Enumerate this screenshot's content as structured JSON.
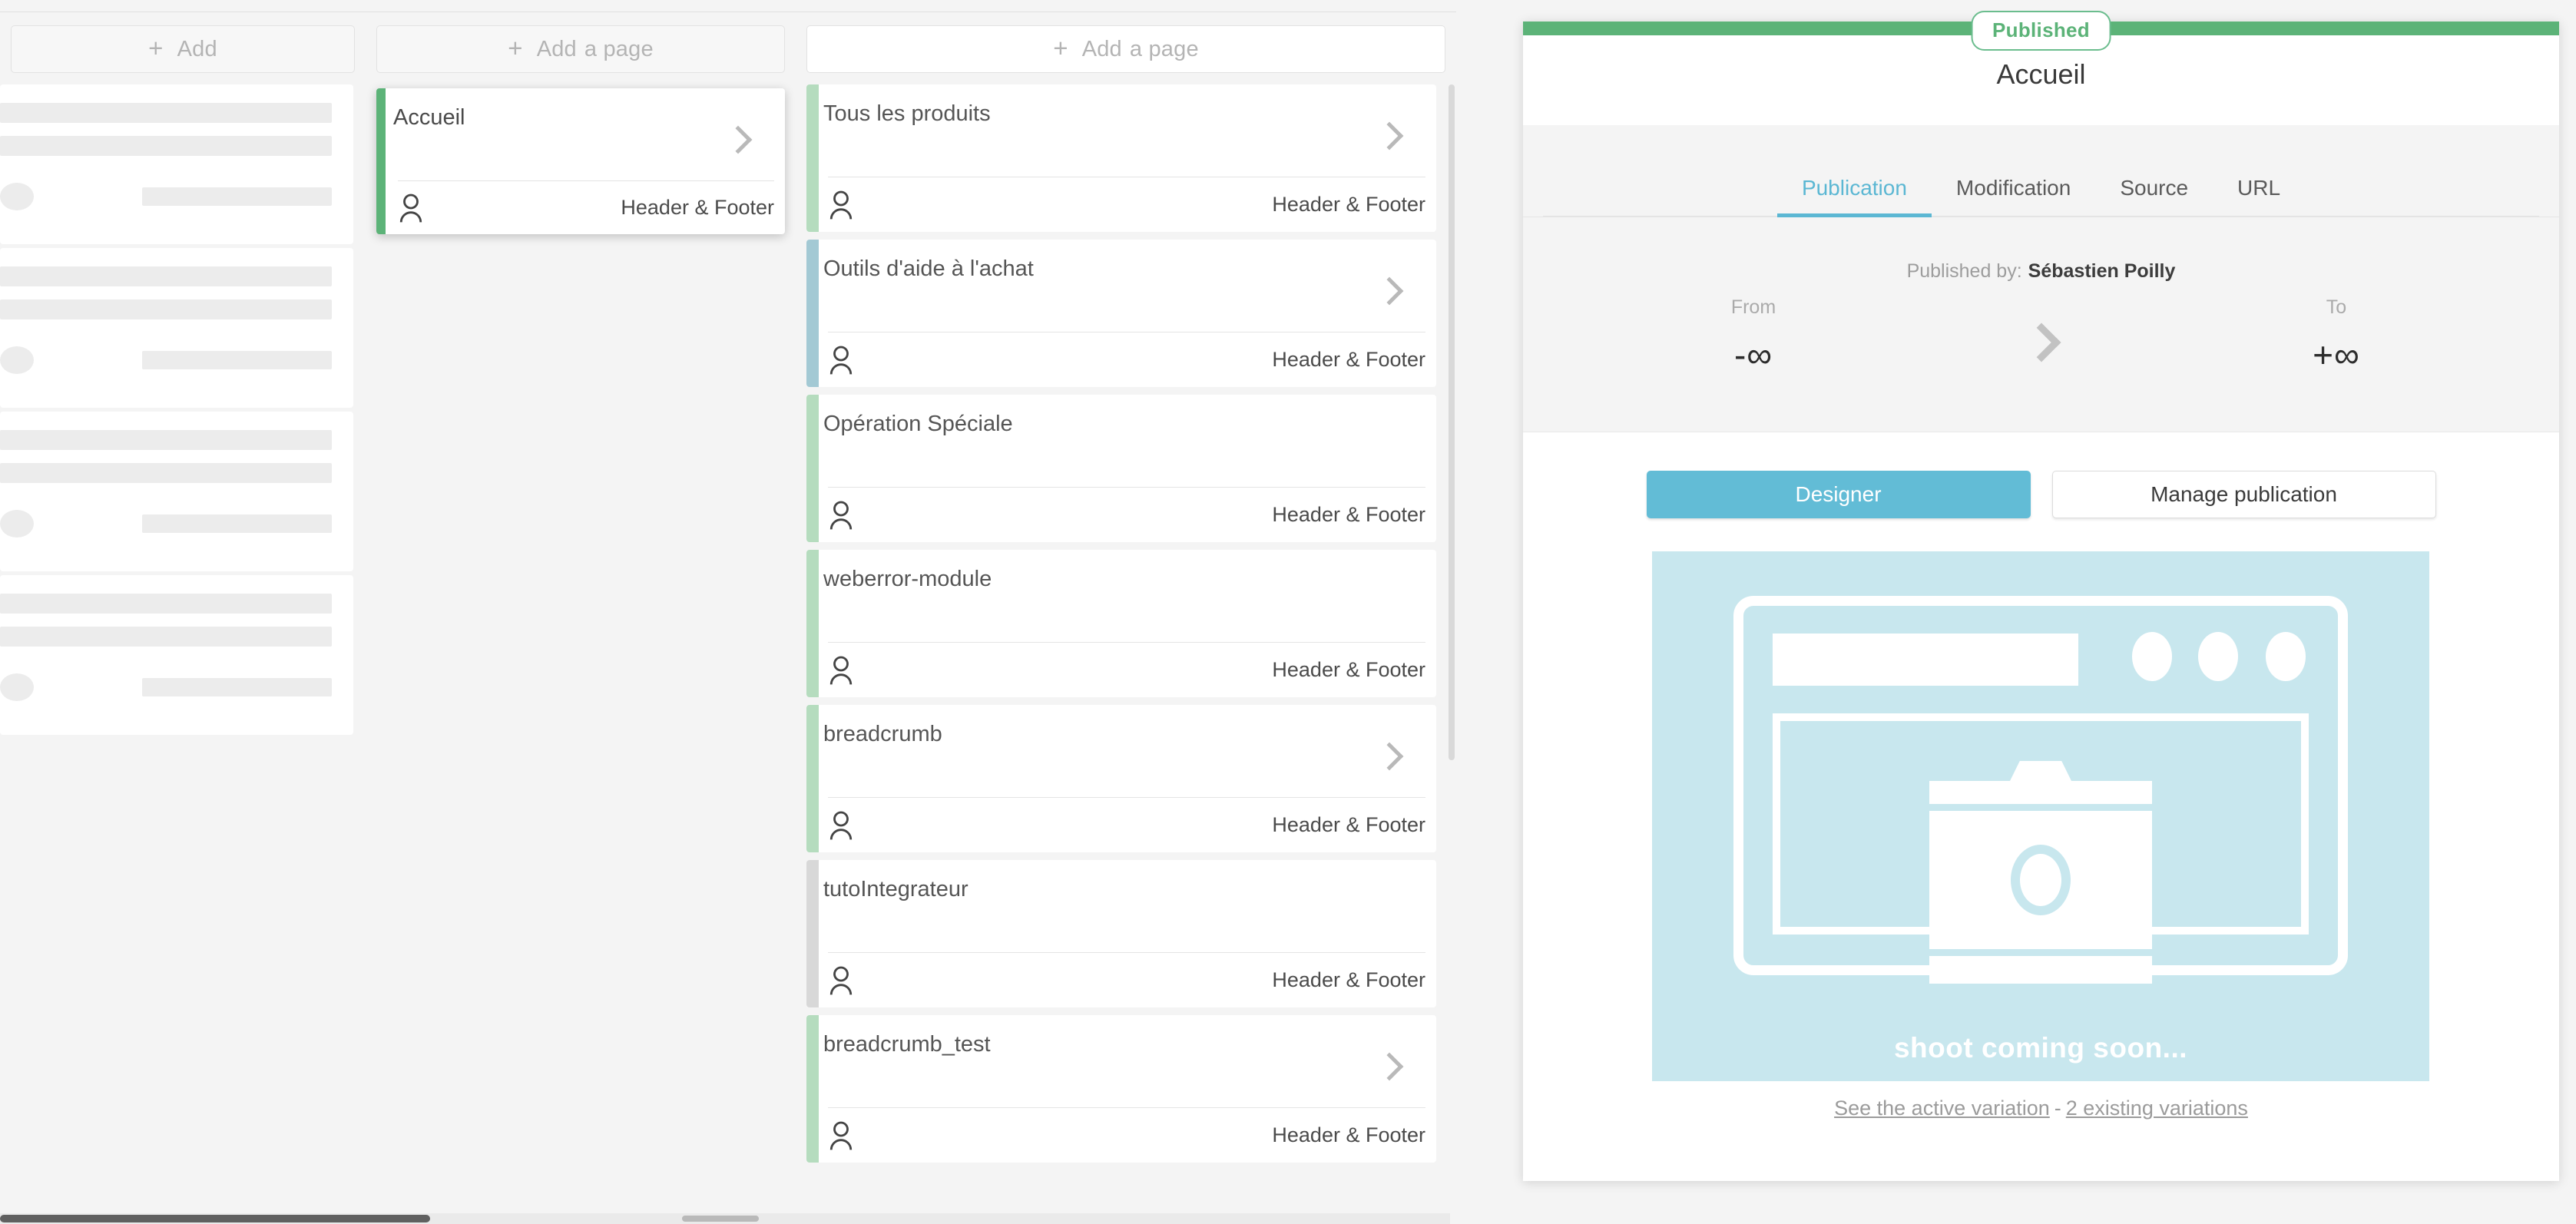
{
  "columns": {
    "skeleton": {
      "add_label": "Add",
      "plus_icon": "plus-icon",
      "placeholder_cards": 4
    },
    "selected": {
      "add_label": "Add",
      "add_label2": "a page",
      "plus_icon": "plus-icon",
      "cards": [
        {
          "title": "Accueil",
          "footer": "Header & Footer",
          "stripe_color": "#5cb378",
          "has_chevron": true,
          "person_icon": "person-icon",
          "selected": true
        }
      ]
    },
    "pages": {
      "add_label": "Add",
      "add_label2": "a page",
      "plus_icon": "plus-icon",
      "cards": [
        {
          "title": "Tous les produits",
          "footer": "Header & Footer",
          "stripe_color": "#b5dcbe",
          "has_chevron": true,
          "person_icon": "person-icon"
        },
        {
          "title": "Outils d'aide à l'achat",
          "footer": "Header & Footer",
          "stripe_color": "#a3c9d4",
          "has_chevron": true,
          "person_icon": "person-icon"
        },
        {
          "title": "Opération Spéciale",
          "footer": "Header & Footer",
          "stripe_color": "#b5dcbe",
          "has_chevron": false,
          "person_icon": "person-icon"
        },
        {
          "title": "weberror-module",
          "footer": "Header & Footer",
          "stripe_color": "#b5dcbe",
          "has_chevron": false,
          "person_icon": "person-icon"
        },
        {
          "title": "breadcrumb",
          "footer": "Header & Footer",
          "stripe_color": "#b5dcbe",
          "has_chevron": true,
          "person_icon": "person-icon"
        },
        {
          "title": "tutoIntegrateur",
          "footer": "Header & Footer",
          "stripe_color": "#d8d8d8",
          "has_chevron": false,
          "person_icon": "person-icon"
        },
        {
          "title": "breadcrumb_test",
          "footer": "Header & Footer",
          "stripe_color": "#b5dcbe",
          "has_chevron": true,
          "person_icon": "person-icon"
        }
      ]
    }
  },
  "detail": {
    "status": "Published",
    "status_color": "#5cb378",
    "title": "Accueil",
    "tabs": [
      {
        "label": "Publication",
        "active": true
      },
      {
        "label": "Modification",
        "active": false
      },
      {
        "label": "Source",
        "active": false
      },
      {
        "label": "URL",
        "active": false
      }
    ],
    "published_by_label": "Published by:",
    "published_by_name": "Sébastien Poilly",
    "range": {
      "from_label": "From",
      "from_value": "-∞",
      "to_label": "To",
      "to_value": "+∞",
      "arrow_icon": "chevron-right-icon"
    },
    "buttons": {
      "primary": "Designer",
      "secondary": "Manage publication",
      "primary_color": "#62bcd6"
    },
    "preview": {
      "caption": "shoot coming soon...",
      "icon": "camera-placeholder-icon",
      "background_color": "#c8e7ee"
    },
    "variations": {
      "active_link": "See the active variation",
      "separator": "-",
      "count_link": "2 existing variations"
    }
  }
}
